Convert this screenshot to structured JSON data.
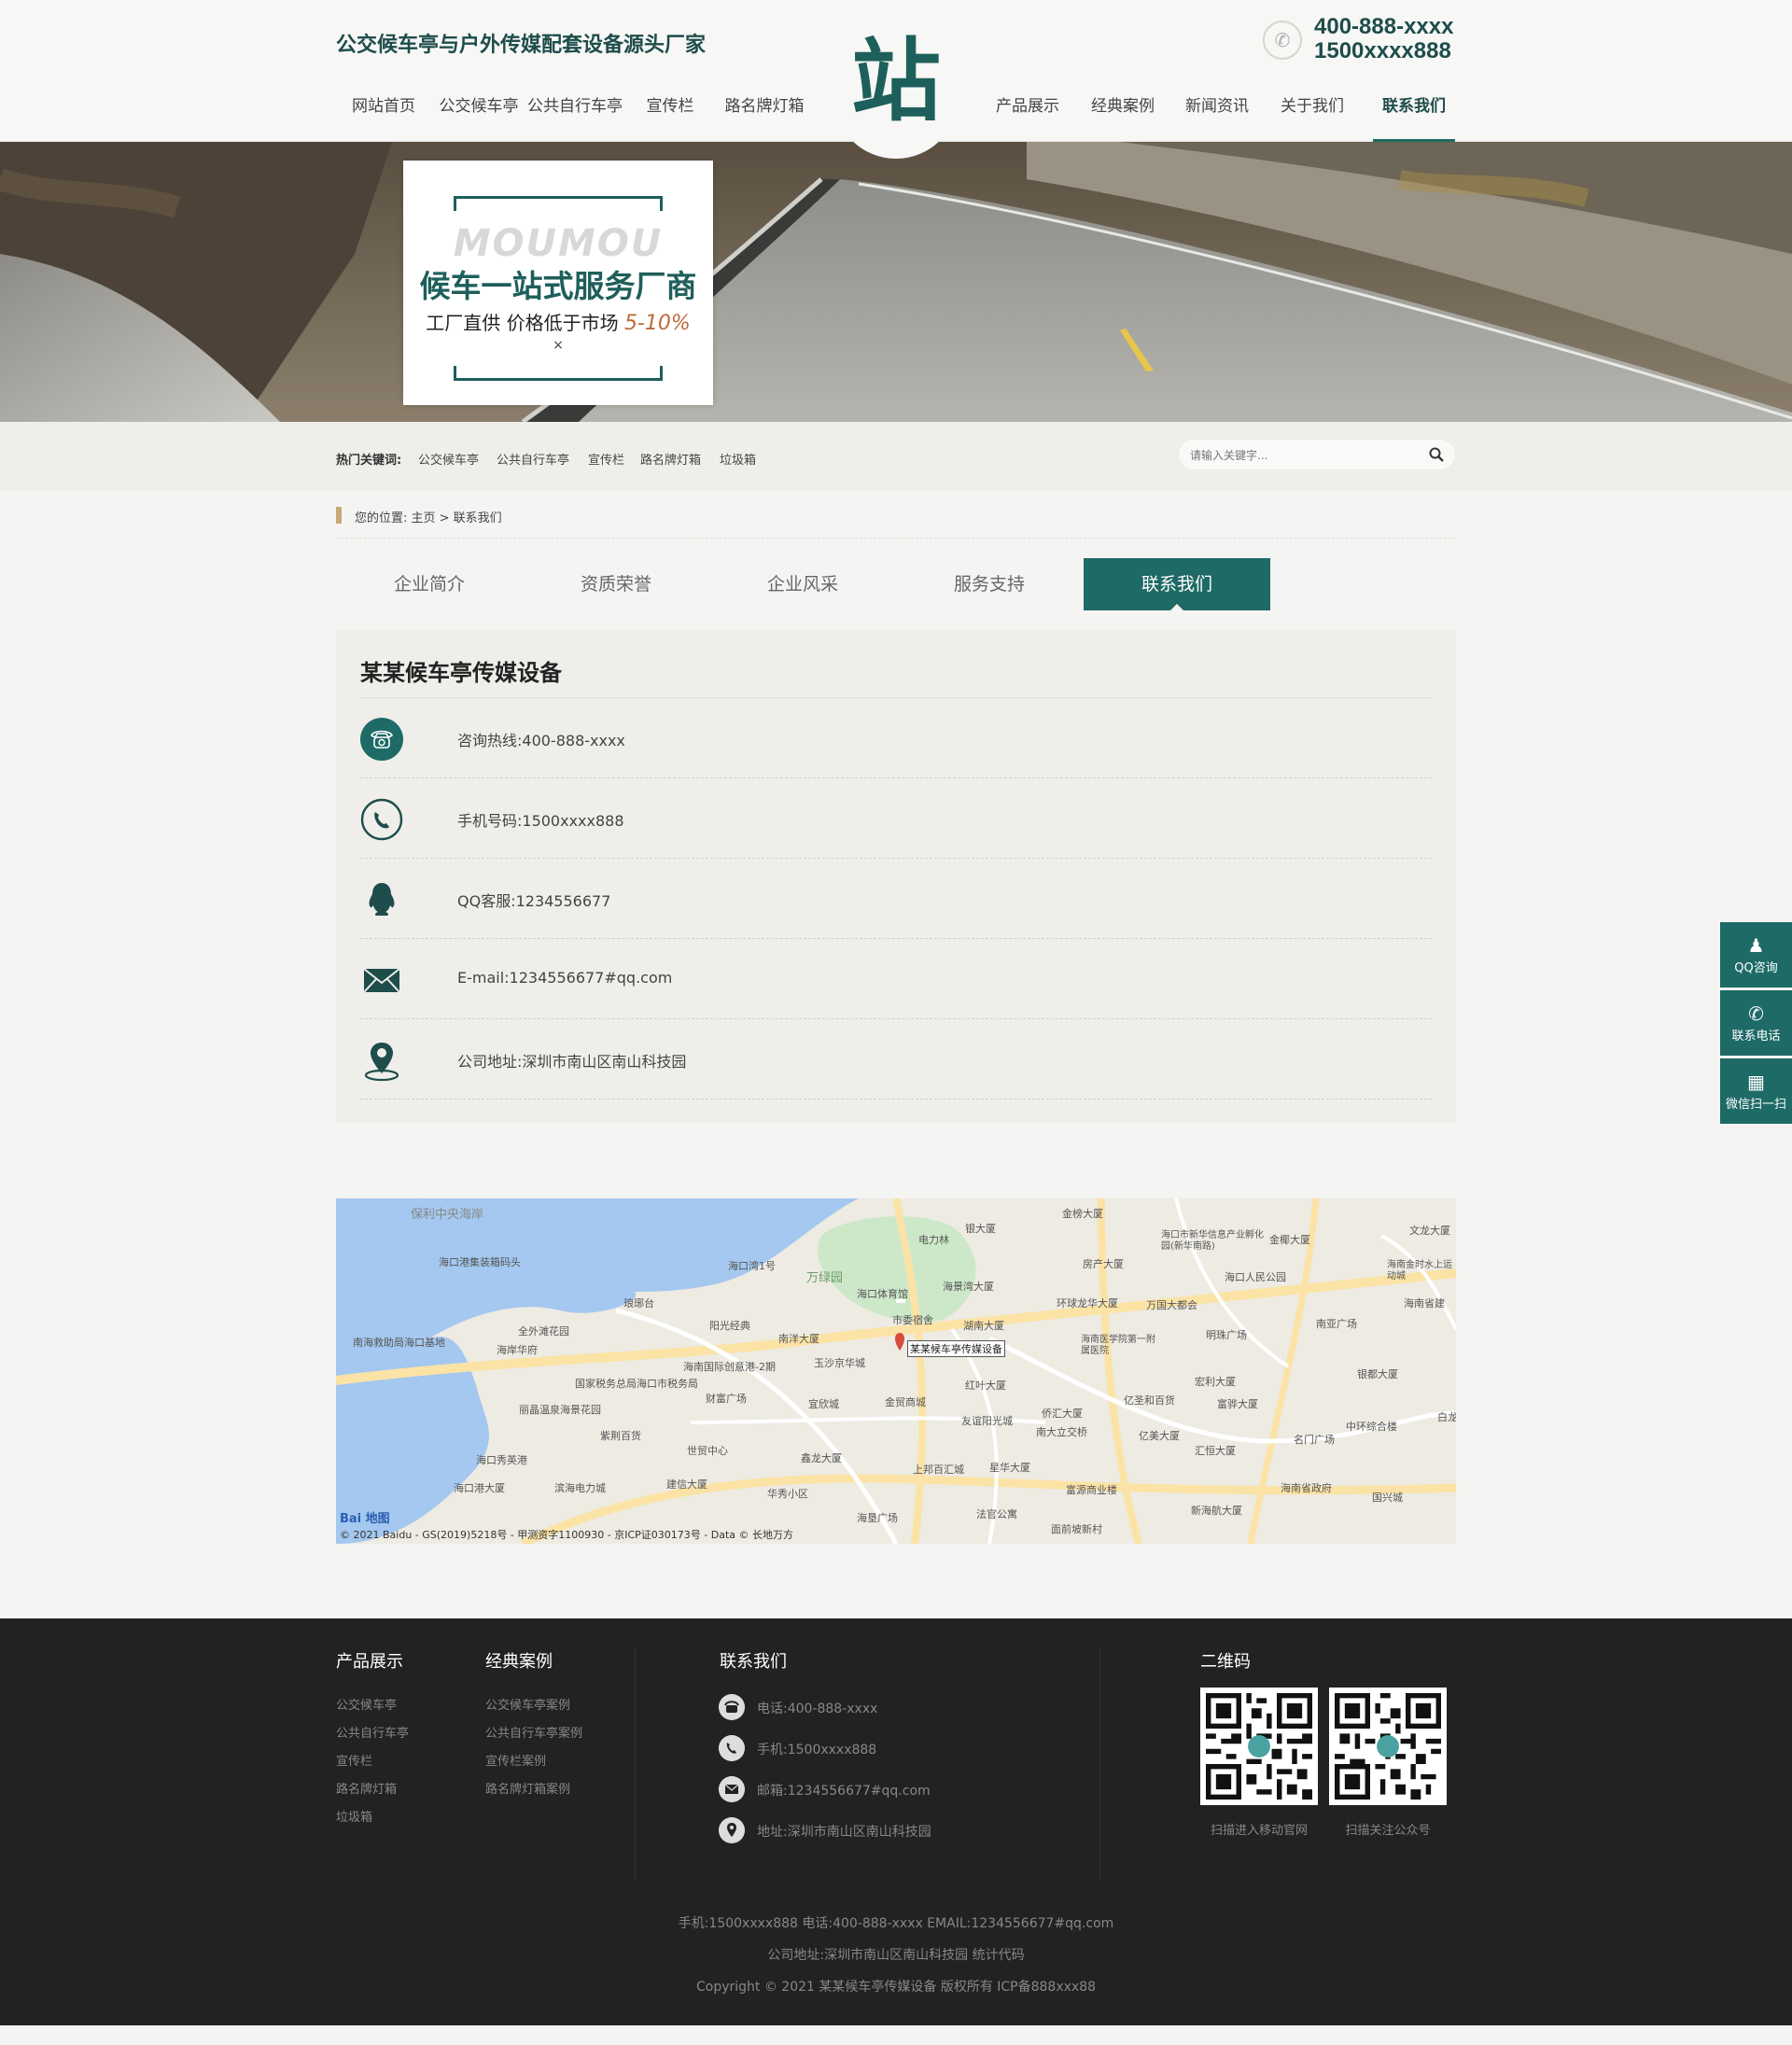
{
  "header": {
    "slogan": "公交候车亭与户外传媒配套设备源头厂家",
    "logo_char": "站",
    "phone1": "400-888-xxxx",
    "phone2": "1500xxxx888",
    "nav_left": [
      "网站首页",
      "公交候车亭",
      "公共自行车亭",
      "宣传栏",
      "路名牌灯箱"
    ],
    "nav_right": [
      "产品展示",
      "经典案例",
      "新闻资讯",
      "关于我们",
      "联系我们"
    ]
  },
  "banner": {
    "en": "MOUMOU",
    "title": "候车一站式服务厂商",
    "sub": "工厂直供  价格低于市场 ",
    "pct": "5-10%",
    "x": "×"
  },
  "keywords": {
    "label": "热门关键词:",
    "items": [
      "公交候车亭",
      "公共自行车亭",
      "宣传栏",
      "路名牌灯箱",
      "垃圾箱"
    ],
    "search_placeholder": "请输入关键字..."
  },
  "breadcrumb": "您的位置:  主页 > 联系我们",
  "tabs": [
    "企业简介",
    "资质荣誉",
    "企业风采",
    "服务支持",
    "联系我们"
  ],
  "contact": {
    "title": "某某候车亭传媒设备",
    "rows": [
      {
        "icon": "telephone-icon",
        "text": "咨询热线:400-888-xxxx"
      },
      {
        "icon": "phone-handset-icon",
        "text": "手机号码:1500xxxx888"
      },
      {
        "icon": "qq-penguin-icon",
        "text": "QQ客服:1234556677"
      },
      {
        "icon": "envelope-icon",
        "text": "E-mail:1234556677#qq.com"
      },
      {
        "icon": "location-pin-icon",
        "text": "公司地址:深圳市南山区南山科技园"
      }
    ]
  },
  "map": {
    "marker_label": "某某候车亭传媒设备",
    "labels": [
      "保利中央海岸",
      "海口港集装箱码头",
      "南海救助局海口基地",
      "海岸华府",
      "全外滩花园",
      "丽晶温泉海景花园",
      "国家税务总局海口市税务局",
      "紫荆百货",
      "海口秀英港",
      "海口港大厦",
      "滨海电力城",
      "建信大厦",
      "世贸中心",
      "海南国际创意港-2期",
      "财富广场",
      "阳光经典",
      "海口湾1号",
      "万绿园",
      "海口体育馆",
      "南洋大厦",
      "玉沙京华城",
      "宜欣城",
      "金贸商城",
      "鑫龙大厦",
      "华秀小区",
      "海垦广场",
      "上邦百汇城",
      "法官公寓",
      "市委宿舍",
      "湖南大厦",
      "红叶大厦",
      "友谊阳光城",
      "星华大厦",
      "侨汇大厦",
      "南大立交桥",
      "富源商业楼",
      "面前坡新村",
      "电力林",
      "银大厦",
      "海景湾大厦",
      "金榜大厦",
      "房产大厦",
      "环球龙华大厦",
      "万国大都会",
      "海口人民公园",
      "海口市新华信息产业孵化园(新华南路)",
      "金椰大厦",
      "明珠广场",
      "海南医学院第一附属医院",
      "宏利大厦",
      "亿圣和百货",
      "富骅大厦",
      "亿美大厦",
      "汇恒大厦",
      "新海航大厦",
      "海南省政府",
      "名门广场",
      "南亚广场",
      "银都大厦",
      "中环综合楼",
      "国兴城",
      "海南金时水上运动城",
      "海南省建",
      "文龙大厦",
      "白龙",
      "琅琊台"
    ],
    "copyright": "© 2021 Baidu - GS(2019)5218号 - 甲测资字1100930 - 京ICP证030173号 - Data © 长地万方",
    "logo": "Bai 地图"
  },
  "side": [
    "QQ咨询",
    "联系电话",
    "微信扫一扫"
  ],
  "footer": {
    "col1_title": "产品展示",
    "col1": [
      "公交候车亭",
      "公共自行车亭",
      "宣传栏",
      "路名牌灯箱",
      "垃圾箱"
    ],
    "col2_title": "经典案例",
    "col2": [
      "公交候车亭案例",
      "公共自行车亭案例",
      "宣传栏案例",
      "路名牌灯箱案例"
    ],
    "col3_title": "联系我们",
    "col3": [
      "电话:400-888-xxxx",
      "手机:1500xxxx888",
      "邮箱:1234556677#qq.com",
      "地址:深圳市南山区南山科技园"
    ],
    "qr_title": "二维码",
    "qr_caps": [
      "扫描进入移动官网",
      "扫描关注公众号"
    ],
    "bottom1": "手机:1500xxxx888  电话:400-888-xxxx  EMAIL:1234556677#qq.com",
    "bottom2": "公司地址:深圳市南山区南山科技园  统计代码",
    "bottom3": "Copyright © 2021 某某候车亭传媒设备 版权所有  ICP备888xxx88"
  }
}
